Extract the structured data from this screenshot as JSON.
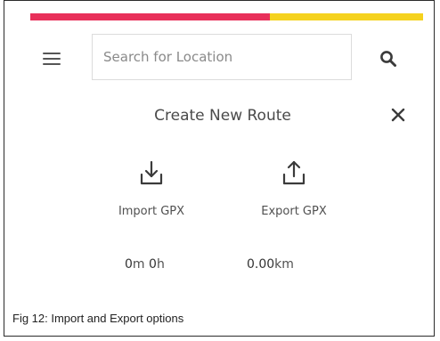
{
  "colors": {
    "accent_primary": "#e8305a",
    "accent_secondary": "#f5d21e",
    "icon": "#3b3b3b"
  },
  "header": {
    "menu_icon": "hamburger-menu-icon",
    "search_placeholder": "Search for Location",
    "search_icon": "search-icon"
  },
  "panel": {
    "title": "Create New Route",
    "close_icon": "close-icon",
    "actions": [
      {
        "label": "Import GPX",
        "icon": "download-icon"
      },
      {
        "label": "Export GPX",
        "icon": "upload-icon"
      }
    ],
    "stats": {
      "duration_minutes": "0",
      "duration_minutes_unit": "m",
      "duration_hours": "0",
      "duration_hours_unit": "h",
      "distance_value": "0.00",
      "distance_unit": "km"
    }
  },
  "caption": "Fig 12: Import and Export options"
}
